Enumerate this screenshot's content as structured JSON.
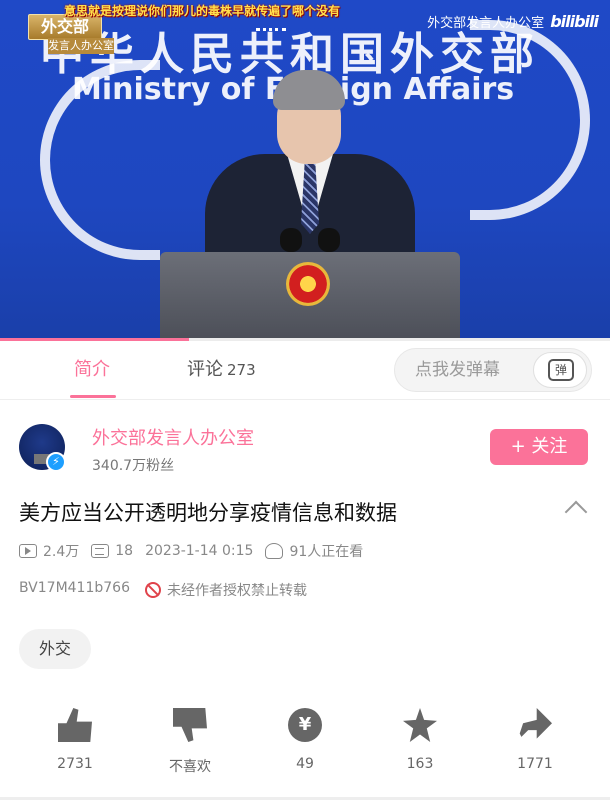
{
  "video": {
    "caption": "意思就是按理说你们那儿的毒株早就传遍了哪个没有",
    "sticker_main": "外交部",
    "sticker_sub": "发言人办公室",
    "bg_title_cn": "中华人民共和国外交部",
    "bg_title_en": "Ministry of Foreign Affairs",
    "watermark_name": "外交部发言人办公室",
    "watermark_logo": "bilibili",
    "progress": 0.31
  },
  "tabs": {
    "intro": "简介",
    "comments": "评论",
    "comments_count": "273"
  },
  "danmu": {
    "placeholder": "点我发弹幕",
    "button_label": "弹"
  },
  "uploader": {
    "name": "外交部发言人办公室",
    "fans": "340.7万粉丝",
    "follow_label": "+ 关注"
  },
  "video_info": {
    "title": "美方应当公开透明地分享疫情信息和数据",
    "views": "2.4万",
    "danmaku": "18",
    "date": "2023-1-14 0:15",
    "watching": "91人正在看",
    "bv": "BV17M411b766",
    "no_reprint": "未经作者授权禁止转载"
  },
  "tags": [
    "外交"
  ],
  "actions": {
    "like": "2731",
    "dislike": "不喜欢",
    "coin": "49",
    "favorite": "163",
    "share": "1771"
  },
  "colors": {
    "accent": "#fb7299",
    "video_bg": "#1f49c7"
  }
}
